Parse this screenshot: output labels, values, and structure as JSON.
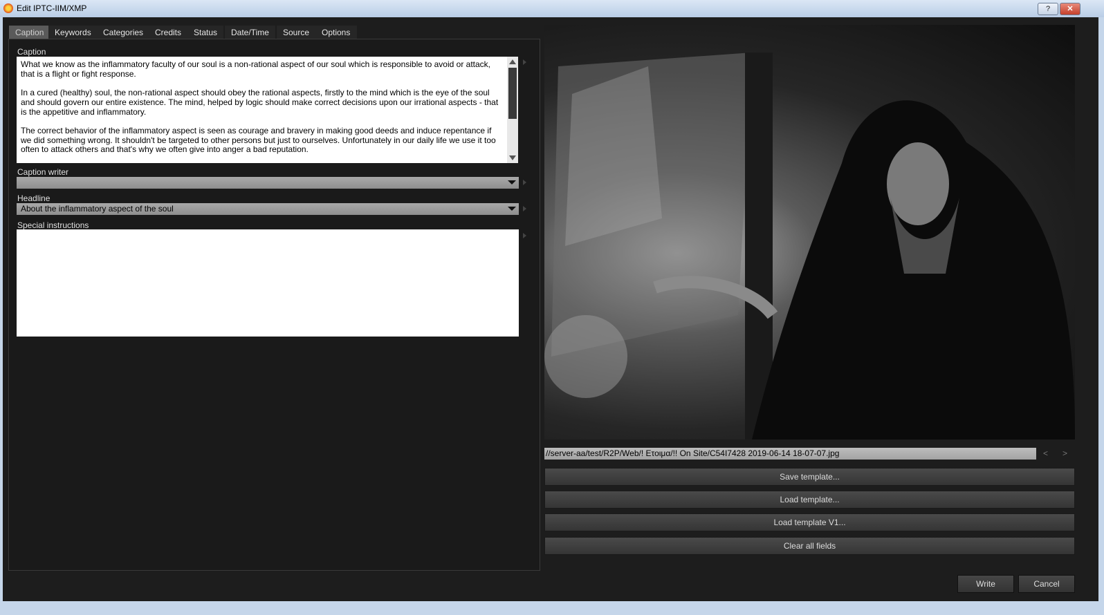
{
  "window": {
    "title": "Edit IPTC-IIM/XMP",
    "help": "?",
    "close": "✕"
  },
  "tabs": [
    "Caption",
    "Keywords",
    "Categories",
    "Credits",
    "Status",
    "Date/Time",
    "Source",
    "Options"
  ],
  "caption": {
    "label": "Caption",
    "value": "What we know as the inflammatory faculty of our soul is a non-rational aspect of our soul which is responsible to avoid or attack, that is a flight or fight response.\n\nIn a cured (healthy) soul, the non-rational aspect should obey the rational aspects, firstly to the mind which is the eye of the soul and should govern our entire existence. The mind, helped by logic should make correct decisions upon our irrational aspects - that is the appetitive and inflammatory.\n\nThe correct behavior of the inflammatory aspect is seen as courage and bravery in making good deeds and induce repentance if we did something wrong. It shouldn't be targeted to other persons but just to ourselves. Unfortunately in our daily life we use it too often to attack others and that's why we often give into anger a bad reputation."
  },
  "caption_writer": {
    "label": "Caption writer",
    "value": ""
  },
  "headline": {
    "label": "Headline",
    "value": "About the inflammatory aspect of the soul"
  },
  "special_instructions": {
    "label": "Special instructions",
    "value": ""
  },
  "file_path": "//server-aa/test/R2P/Web/! Ετοιμα/!! On Site/C54I7428 2019-06-14 18-07-07.jpg",
  "nav": {
    "prev": "<",
    "next": ">"
  },
  "buttons": {
    "save_template": "Save template...",
    "load_template": "Load template...",
    "load_template_v1": "Load template V1...",
    "clear_all": "Clear all fields",
    "write": "Write",
    "cancel": "Cancel"
  }
}
